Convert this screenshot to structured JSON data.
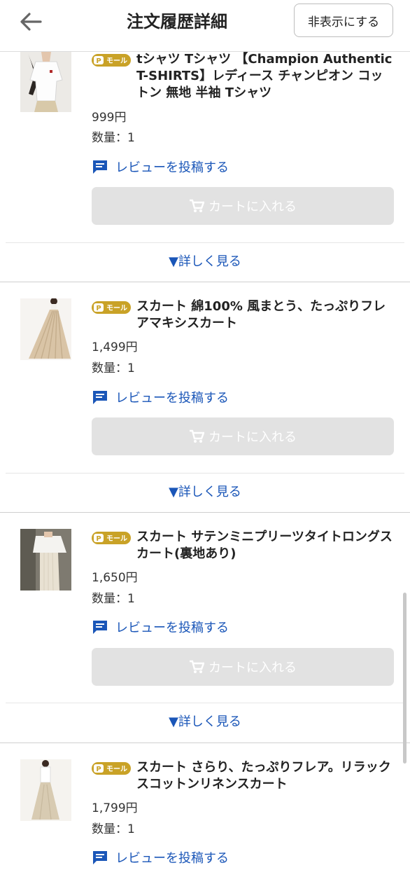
{
  "header": {
    "title": "注文履歴詳細",
    "hide_label": "非表示にする"
  },
  "badge_label": "モール",
  "items": [
    {
      "name": "tシャツ Tシャツ 【Champion Authentic T-SHIRTS】レディース チャンピオン コットン 無地 半袖 Tシャツ",
      "price": "999円",
      "quantity": "数量：1",
      "review_label": "レビューを投稿する",
      "cart_label": "カートに入れる",
      "more_label": "▼詳しく見る"
    },
    {
      "name": "スカート 綿100% 風まとう、たっぷりフレアマキシスカート",
      "price": "1,499円",
      "quantity": "数量：1",
      "review_label": "レビューを投稿する",
      "cart_label": "カートに入れる",
      "more_label": "▼詳しく見る"
    },
    {
      "name": "スカート サテンミニプリーツタイトロングスカート(裏地あり)",
      "price": "1,650円",
      "quantity": "数量：1",
      "review_label": "レビューを投稿する",
      "cart_label": "カートに入れる",
      "more_label": "▼詳しく見る"
    },
    {
      "name": "スカート さらり、たっぷりフレア。リラックスコットンリネンスカート",
      "price": "1,799円",
      "quantity": "数量：1",
      "review_label": "レビューを投稿する"
    }
  ],
  "colors": {
    "link": "#1a56b8",
    "badge": "#c9a227",
    "cart_disabled": "#e2e2e2"
  }
}
